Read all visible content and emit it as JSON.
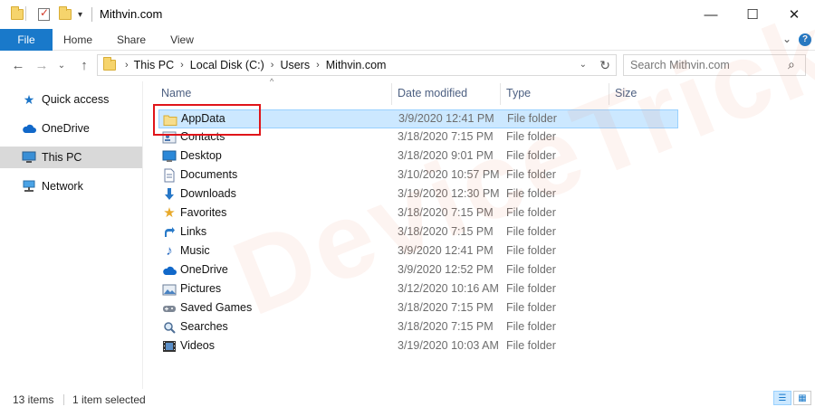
{
  "window": {
    "title": "Mithvin.com",
    "minimize_glyph": "—",
    "maximize_glyph": "☐",
    "close_glyph": "✕"
  },
  "ribbon": {
    "tabs": [
      "File",
      "Home",
      "Share",
      "View"
    ],
    "accent": "#1979ca",
    "help_glyph": "?"
  },
  "address": {
    "crumbs": [
      "This PC",
      "Local Disk (C:)",
      "Users",
      "Mithvin.com"
    ]
  },
  "search": {
    "placeholder": "Search Mithvin.com"
  },
  "nav": {
    "items": [
      {
        "label": "Quick access",
        "icon": "star-icon"
      },
      {
        "label": "OneDrive",
        "icon": "cloud-icon"
      },
      {
        "label": "This PC",
        "icon": "computer-icon"
      },
      {
        "label": "Network",
        "icon": "network-icon"
      }
    ],
    "selected": "This PC"
  },
  "columns": [
    "Name",
    "Date modified",
    "Type",
    "Size"
  ],
  "files": [
    {
      "name": "AppData",
      "date": "3/9/2020 12:41 PM",
      "type": "File folder",
      "icon": "folder-icon"
    },
    {
      "name": "Contacts",
      "date": "3/18/2020 7:15 PM",
      "type": "File folder",
      "icon": "contacts-icon"
    },
    {
      "name": "Desktop",
      "date": "3/18/2020 9:01 PM",
      "type": "File folder",
      "icon": "desktop-icon"
    },
    {
      "name": "Documents",
      "date": "3/10/2020 10:57 PM",
      "type": "File folder",
      "icon": "documents-icon"
    },
    {
      "name": "Downloads",
      "date": "3/19/2020 12:30 PM",
      "type": "File folder",
      "icon": "download-arrow-icon"
    },
    {
      "name": "Favorites",
      "date": "3/18/2020 7:15 PM",
      "type": "File folder",
      "icon": "star-icon"
    },
    {
      "name": "Links",
      "date": "3/18/2020 7:15 PM",
      "type": "File folder",
      "icon": "link-arrow-icon"
    },
    {
      "name": "Music",
      "date": "3/9/2020 12:41 PM",
      "type": "File folder",
      "icon": "music-note-icon"
    },
    {
      "name": "OneDrive",
      "date": "3/9/2020 12:52 PM",
      "type": "File folder",
      "icon": "cloud-icon"
    },
    {
      "name": "Pictures",
      "date": "3/12/2020 10:16 AM",
      "type": "File folder",
      "icon": "pictures-icon"
    },
    {
      "name": "Saved Games",
      "date": "3/18/2020 7:15 PM",
      "type": "File folder",
      "icon": "games-icon"
    },
    {
      "name": "Searches",
      "date": "3/18/2020 7:15 PM",
      "type": "File folder",
      "icon": "search-icon"
    },
    {
      "name": "Videos",
      "date": "3/19/2020 10:03 AM",
      "type": "File folder",
      "icon": "film-icon"
    }
  ],
  "selected_file": "AppData",
  "status": {
    "count": "13 items",
    "selection": "1 item selected"
  },
  "watermark": "DeviceTricks"
}
